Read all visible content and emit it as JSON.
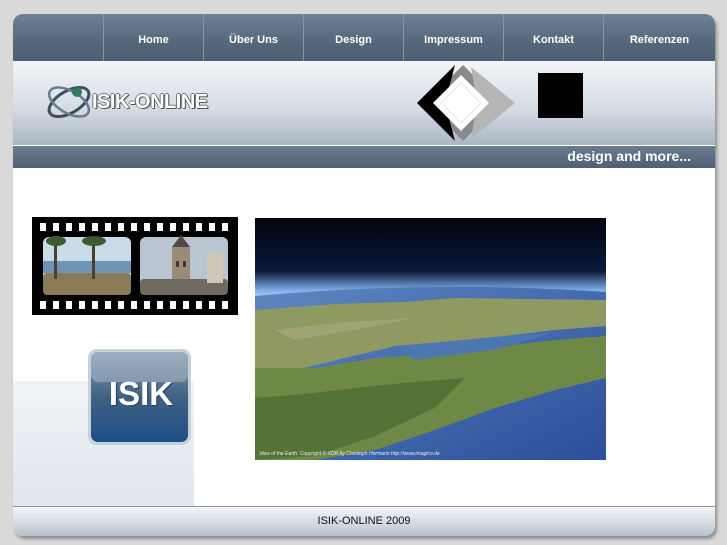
{
  "nav": {
    "items": [
      {
        "label": "Home"
      },
      {
        "label": "Über Uns"
      },
      {
        "label": "Design"
      },
      {
        "label": "Impressum"
      },
      {
        "label": "Kontakt"
      },
      {
        "label": "Referenzen"
      }
    ]
  },
  "header": {
    "logo_text": "ISIK-ONLINE",
    "tagline": "design and more..."
  },
  "content": {
    "badge_text": "ISIK",
    "earth_caption": "View of the Earth. Copyright © XDR by Christoph Hormann http://www.imagico.de"
  },
  "footer": {
    "text": "ISIK-ONLINE 2009"
  },
  "colors": {
    "nav_bar": "#55677b",
    "tagline_bar": "#5a6b7e",
    "page_background": "#d9d9d9"
  }
}
